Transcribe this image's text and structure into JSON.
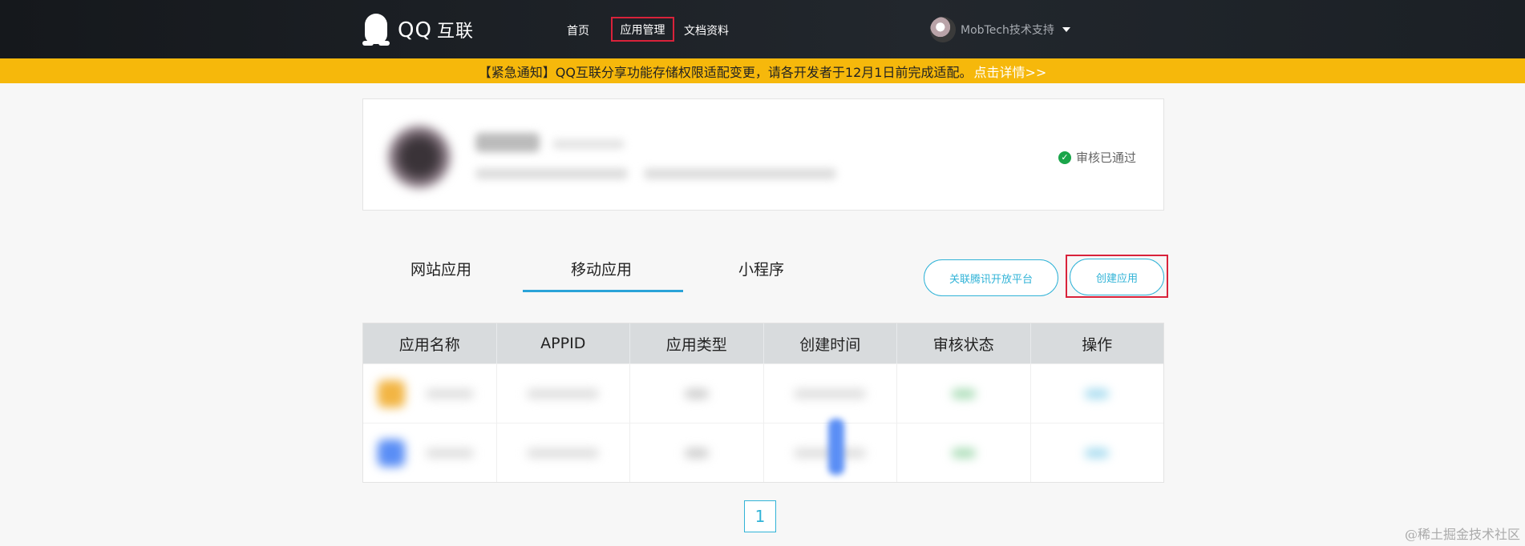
{
  "header": {
    "logo_text": "QQ",
    "logo_cn": "互联",
    "nav": {
      "home": "首页",
      "app_manage": "应用管理",
      "docs": "文档资料"
    },
    "user_name": "MobTech技术支持"
  },
  "notice": {
    "text": "【紧急通知】QQ互联分享功能存储权限适配变更，请各开发者于12月1日前完成适配。",
    "link": "点击详情>>"
  },
  "profile": {
    "status": "审核已通过"
  },
  "tabs": {
    "web": "网站应用",
    "mobile": "移动应用",
    "mini": "小程序"
  },
  "actions": {
    "link_platform": "关联腾讯开放平台",
    "create_app": "创建应用"
  },
  "table": {
    "headers": [
      "应用名称",
      "APPID",
      "应用类型",
      "创建时间",
      "审核状态",
      "操作"
    ]
  },
  "pagination": {
    "current": "1"
  },
  "watermark": "@稀土掘金技术社区",
  "colors": {
    "accent": "#31b3d7",
    "highlight": "#d9223a",
    "notice_bg": "#f6b80b",
    "ok": "#1aa54a"
  }
}
